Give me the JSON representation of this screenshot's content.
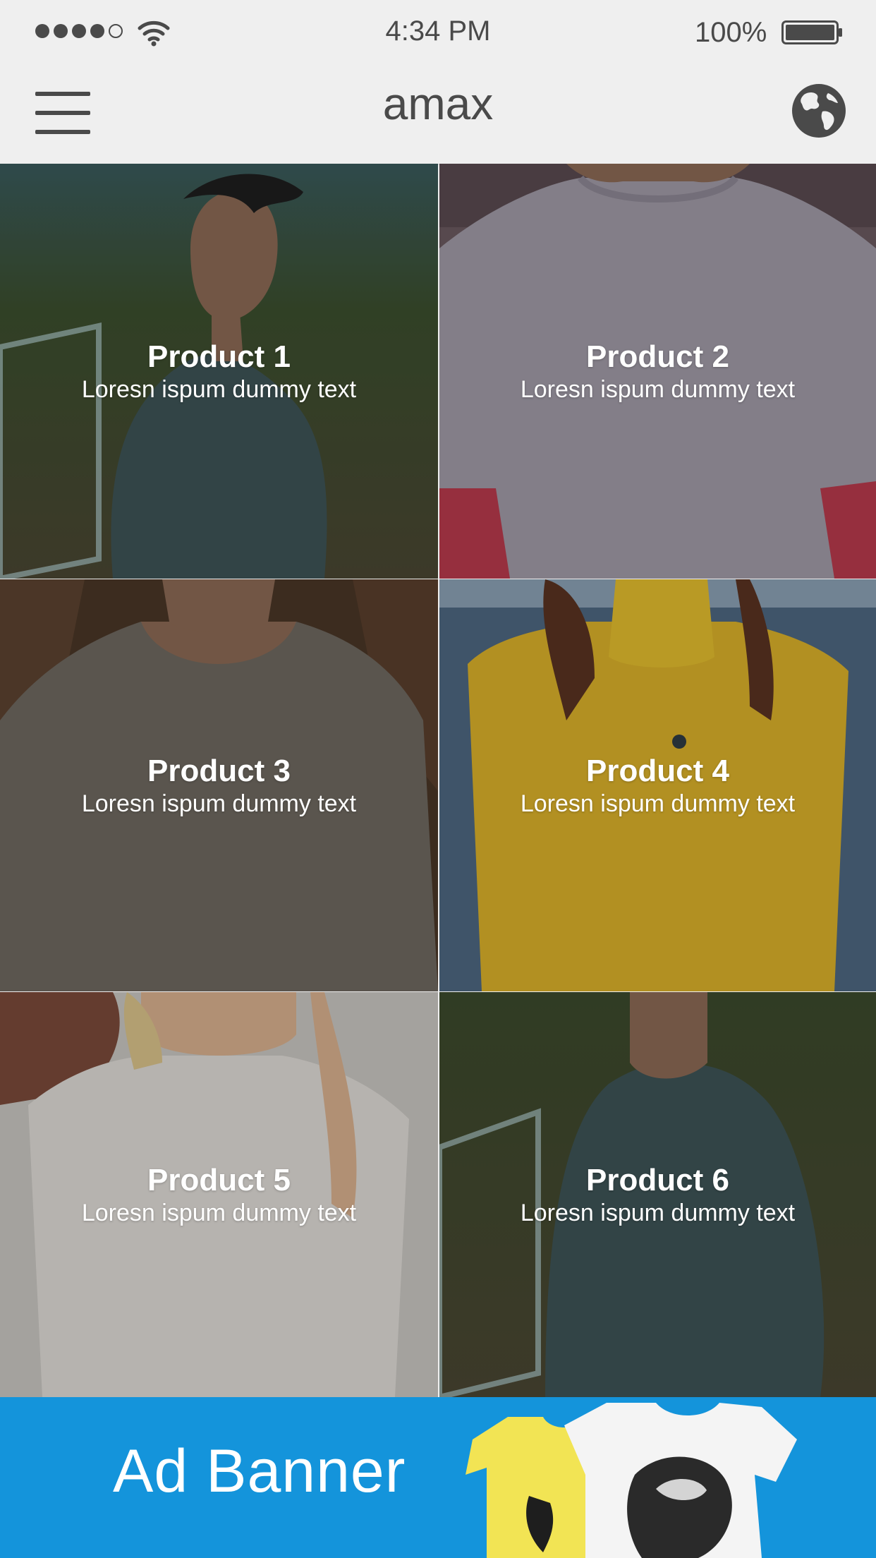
{
  "status_bar": {
    "time": "4:34 PM",
    "battery": "100%",
    "signal_icon": "signal-dots-icon",
    "wifi_icon": "wifi-icon",
    "battery_icon": "battery-icon"
  },
  "nav": {
    "title": "amax",
    "menu_icon": "hamburger-menu-icon",
    "globe_icon": "globe-icon"
  },
  "products": [
    {
      "name": "Product 1",
      "description": "Loresn ispum dummy text"
    },
    {
      "name": "Product 2",
      "description": "Loresn ispum dummy text"
    },
    {
      "name": "Product 3",
      "description": "Loresn ispum dummy text"
    },
    {
      "name": "Product 4",
      "description": "Loresn ispum dummy text"
    },
    {
      "name": "Product 5",
      "description": "Loresn ispum dummy text"
    },
    {
      "name": "Product 6",
      "description": "Loresn ispum dummy text"
    }
  ],
  "ad_banner": {
    "label": "Ad Banner",
    "color": "#1494db"
  },
  "colors": {
    "bar_background": "#efefef",
    "icon_gray": "#4a4a4a"
  }
}
